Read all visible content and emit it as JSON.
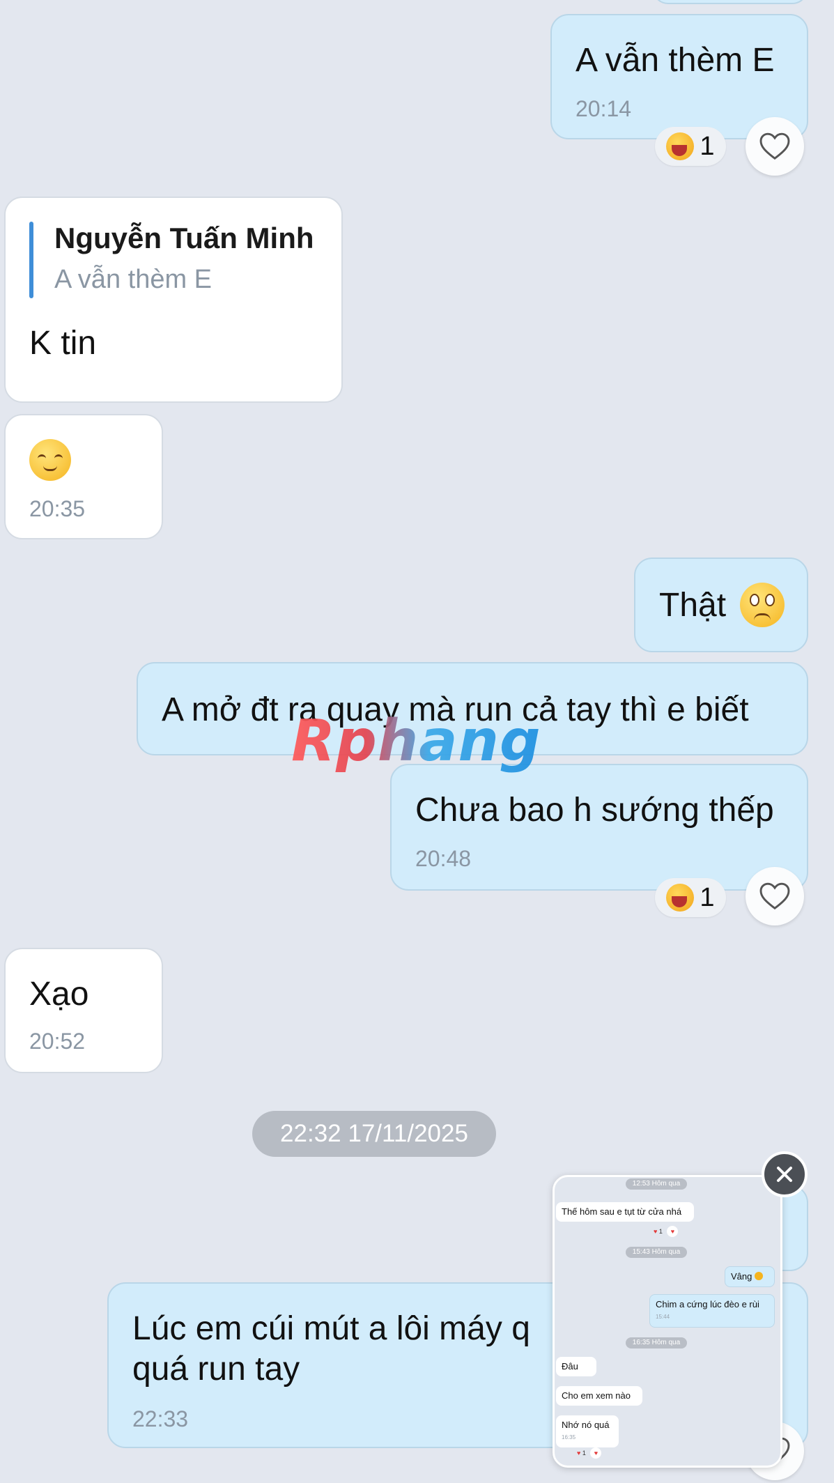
{
  "messages": {
    "m1": {
      "text": "A vẫn thèm E",
      "time": "20:14",
      "reaction_count": "1"
    },
    "m2": {
      "quote_author": "Nguyễn Tuấn Minh",
      "quote_text": "A vẫn thèm E",
      "text": "K tin"
    },
    "m3": {
      "time": "20:35"
    },
    "m4": {
      "text": "Thật"
    },
    "m5": {
      "text": "A mở đt ra quay mà run cả tay thì e biết"
    },
    "m6": {
      "text": "Chưa bao h sướng thếp",
      "time": "20:48",
      "reaction_count": "1"
    },
    "m7": {
      "text": "Xạo",
      "time": "20:52"
    },
    "date_separator": "22:32 17/11/2025",
    "m8": {
      "text": "Lúc em cúi mút a lôi máy q\nquá run tay",
      "time": "22:33"
    }
  },
  "watermark": "Rphang",
  "overlay": {
    "pill1": "12:53 Hôm qua",
    "b1": "Thế hôm sau e tụt từ cửa nhá",
    "b1_reaction": "1",
    "pill2": "15:43 Hôm qua",
    "b2": "Vâng",
    "b3": "Chim a cứng lúc đèo e rùi",
    "b3_time": "15:44",
    "pill3": "16:35 Hôm qua",
    "b4": "Đâu",
    "b5": "Cho em xem nào",
    "b6": "Nhớ nó quá",
    "b6_time": "16:35",
    "b6_reaction": "1"
  },
  "colors": {
    "background": "#e3e7ef",
    "outgoing_bubble": "#d2ecfb",
    "incoming_bubble": "#ffffff",
    "quote_bar": "#3f8ed8"
  },
  "icons": [
    "laughing-emoji-icon",
    "heart-icon",
    "relieved-emoji-icon",
    "frowning-emoji-icon",
    "close-icon"
  ]
}
